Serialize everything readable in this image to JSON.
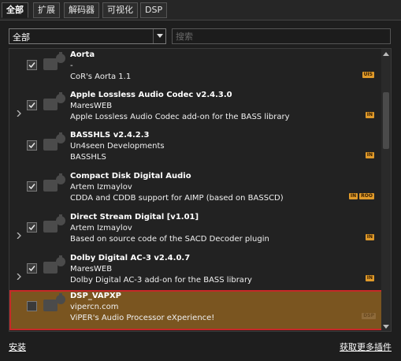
{
  "tabs": [
    {
      "label": "全部",
      "active": true
    },
    {
      "label": "扩展",
      "active": false
    },
    {
      "label": "解码器",
      "active": false
    },
    {
      "label": "可视化",
      "active": false
    },
    {
      "label": "DSP",
      "active": false
    }
  ],
  "filter": {
    "selected": "全部"
  },
  "search": {
    "placeholder": "搜索",
    "value": ""
  },
  "plugins": [
    {
      "title": "Aorta",
      "author": "-",
      "desc": "CoR's Aorta 1.1",
      "badges": [
        "UIS"
      ],
      "checked": true,
      "expandable": false,
      "selected": false
    },
    {
      "title": "Apple Lossless Audio Codec v2.4.3.0",
      "author": "MaresWEB",
      "desc": "Apple Lossless Audio Codec add-on for the BASS library",
      "badges": [
        "IN"
      ],
      "checked": true,
      "expandable": true,
      "selected": false
    },
    {
      "title": "BASSHLS v2.4.2.3",
      "author": "Un4seen Developments",
      "desc": "BASSHLS",
      "badges": [
        "IN"
      ],
      "checked": true,
      "expandable": false,
      "selected": false
    },
    {
      "title": "Compact Disk Digital Audio",
      "author": "Artem Izmaylov",
      "desc": "CDDA and CDDB support for AIMP (based on BASSCD)",
      "badges": [
        "IN",
        "ROO"
      ],
      "checked": true,
      "expandable": false,
      "selected": false
    },
    {
      "title": "Direct Stream Digital [v1.01]",
      "author": "Artem Izmaylov",
      "desc": "Based on source code of the SACD Decoder plugin",
      "badges": [
        "IN"
      ],
      "checked": true,
      "expandable": true,
      "selected": false
    },
    {
      "title": "Dolby Digital AC-3 v2.4.0.7",
      "author": "MaresWEB",
      "desc": "Dolby Digital AC-3 add-on for the BASS library",
      "badges": [
        "IN"
      ],
      "checked": true,
      "expandable": true,
      "selected": false
    },
    {
      "title": "DSP_VAPXP",
      "author": "vipercn.com",
      "desc": "ViPER's Audio Processor eXperience!",
      "badges": [
        "DSP"
      ],
      "checked": false,
      "expandable": false,
      "selected": true
    }
  ],
  "footer": {
    "install": "安装",
    "more": "获取更多插件"
  },
  "colors": {
    "accent": "#e09a2a",
    "selected_row": "#7a5520",
    "selection_border": "#c62828"
  }
}
